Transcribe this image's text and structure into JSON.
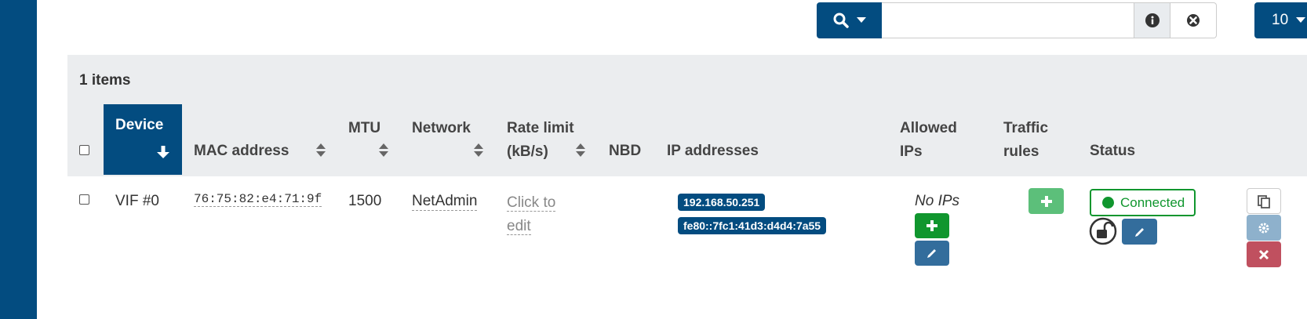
{
  "toolbar": {
    "search_placeholder": "",
    "search_value": "",
    "page_size": "10"
  },
  "table": {
    "items_count": "1 items",
    "headers": {
      "device": "Device",
      "mac": "MAC address",
      "mtu": "MTU",
      "network": "Network",
      "rate_limit_1": "Rate limit",
      "rate_limit_2": "(kB/s)",
      "nbd": "NBD",
      "ip_addresses": "IP addresses",
      "allowed_ips_1": "Allowed",
      "allowed_ips_2": "IPs",
      "traffic_rules_1": "Traffic",
      "traffic_rules_2": "rules",
      "status": "Status"
    },
    "rows": [
      {
        "device": "VIF #0",
        "mac": "76:75:82:e4:71:9f",
        "mtu": "1500",
        "network": "NetAdmin",
        "rate_limit_1": "Click to",
        "rate_limit_2": "edit",
        "ip_addresses": [
          "192.168.50.251",
          "fe80::7fc1:41d3:d4d4:7a55"
        ],
        "allowed_ips": "No IPs",
        "status": "Connected"
      }
    ]
  },
  "colors": {
    "brand": "#034c80",
    "success": "#10962e",
    "danger": "#c0505f",
    "panel": "#ebedef"
  },
  "icons": [
    "search-icon",
    "caret-down-icon",
    "info-icon",
    "clear-icon",
    "sort-icon",
    "arrow-down-icon",
    "plus-icon",
    "pencil-icon",
    "unlock-icon",
    "copy-icon",
    "gear-icon",
    "close-icon"
  ]
}
